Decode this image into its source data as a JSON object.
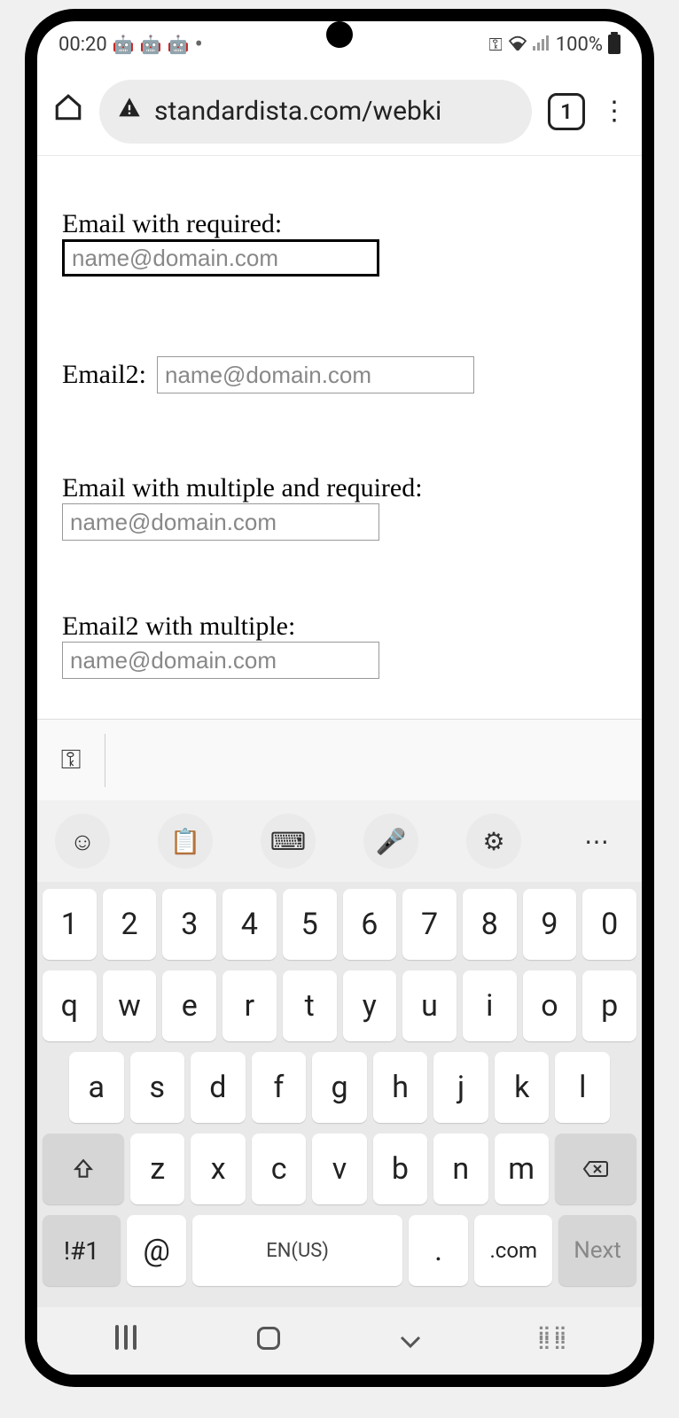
{
  "status_bar": {
    "time": "00:20",
    "battery_pct": "100%"
  },
  "browser": {
    "url": "standardista.com/webki",
    "tab_count": "1"
  },
  "form": {
    "fields": [
      {
        "label": "Email with required:",
        "placeholder": "name@domain.com",
        "focused": true,
        "inline": false
      },
      {
        "label": "Email2:",
        "placeholder": "name@domain.com",
        "focused": false,
        "inline": true
      },
      {
        "label": "Email with multiple and required:",
        "placeholder": "name@domain.com",
        "focused": false,
        "inline": false
      },
      {
        "label": "Email2 with multiple:",
        "placeholder": "name@domain.com",
        "focused": false,
        "inline": false
      }
    ]
  },
  "keyboard": {
    "row1": [
      "1",
      "2",
      "3",
      "4",
      "5",
      "6",
      "7",
      "8",
      "9",
      "0"
    ],
    "row2": [
      "q",
      "w",
      "e",
      "r",
      "t",
      "y",
      "u",
      "i",
      "o",
      "p"
    ],
    "row3": [
      "a",
      "s",
      "d",
      "f",
      "g",
      "h",
      "j",
      "k",
      "l"
    ],
    "row4_letters": [
      "z",
      "x",
      "c",
      "v",
      "b",
      "n",
      "m"
    ],
    "sym_key": "!#1",
    "at_key": "@",
    "space_label": "EN(US)",
    "dot_key": ".",
    "com_key": ".com",
    "next_key": "Next"
  }
}
